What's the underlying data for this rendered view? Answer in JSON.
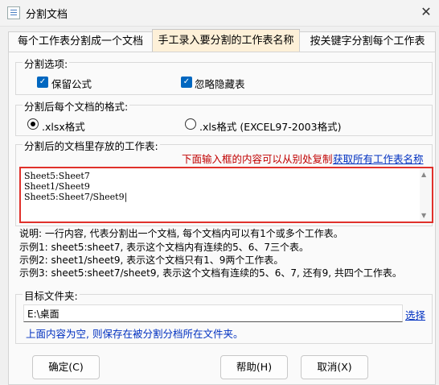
{
  "window": {
    "title": "分割文档"
  },
  "tabs": [
    {
      "label": "每个工作表分割成一个文档"
    },
    {
      "label": "手工录入要分割的工作表名称"
    },
    {
      "label": "按关键字分割每个工作表"
    }
  ],
  "split_options": {
    "title": "分割选项:",
    "keep_formula": "保留公式",
    "ignore_hidden": "忽略隐藏表"
  },
  "format": {
    "title": "分割后每个文档的格式:",
    "xlsx": ".xlsx格式",
    "xls": ".xls格式 (EXCEL97-2003格式)"
  },
  "sheets": {
    "title": "分割后的文档里存放的工作表:",
    "hint": "下面输入框的内容可以从别处复制",
    "get_all_link": "获取所有工作表名称",
    "lines": [
      "Sheet5:Sheet7",
      "Sheet1/Sheet9",
      "Sheet5:Sheet7/Sheet9"
    ]
  },
  "help": {
    "desc": "说明: 一行内容, 代表分割出一个文档, 每个文档内可以有1个或多个工作表。",
    "ex1": "示例1: sheet5:sheet7, 表示这个文档内有连续的5、6、7三个表。",
    "ex2": "示例2: sheet1/sheet9, 表示这个文档只有1、9两个工作表。",
    "ex3": "示例3: sheet5:sheet7/sheet9, 表示这个文档有连续的5、6、7, 还有9, 共四个工作表。"
  },
  "target": {
    "title": "目标文件夹:",
    "value": "E:\\桌面",
    "browse": "选择",
    "note": "上面内容为空, 则保存在被分割分档所在文件夹。"
  },
  "buttons": {
    "ok": "确定(C)",
    "help": "帮助(H)",
    "cancel": "取消(X)"
  },
  "colors": {
    "accent": "#0067c0",
    "link": "#0030c0",
    "hint": "#c00000",
    "highlight_border": "#e0312b",
    "active_tab": "#fdf0d8"
  }
}
